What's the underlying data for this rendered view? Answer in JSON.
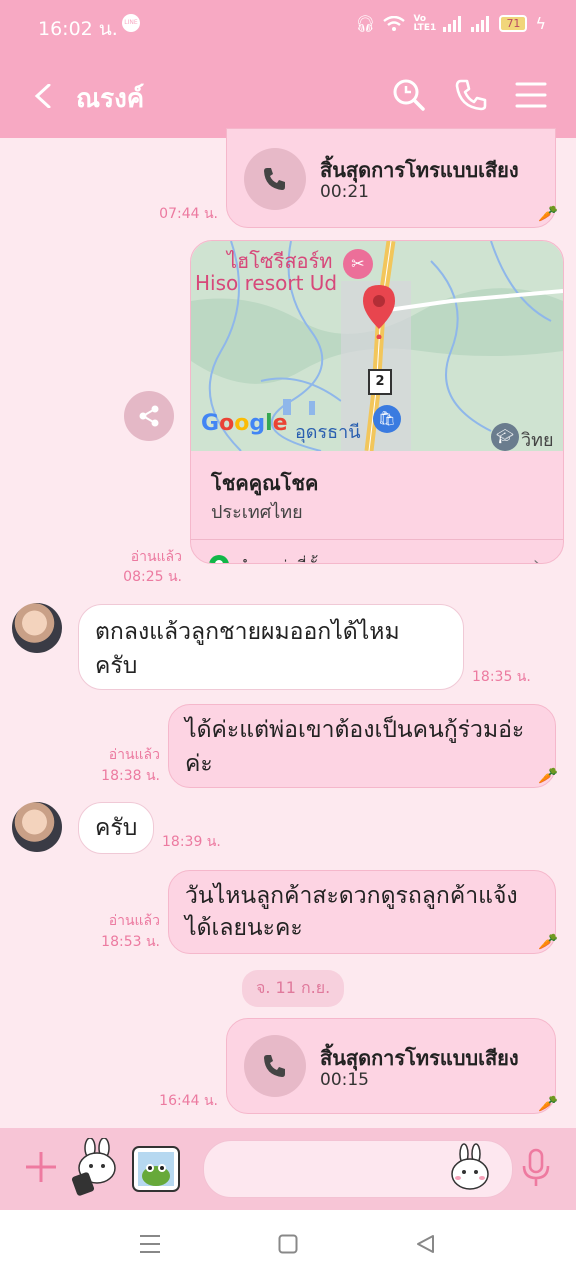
{
  "status": {
    "time": "16:02 น.",
    "network_vo": "Vo LTE1",
    "battery": "71"
  },
  "header": {
    "contact_name": "ณรงค์",
    "colors": {
      "bar": "#f7a9c3",
      "icon": "#ffffff"
    },
    "icons": [
      "chevron-left-icon",
      "search-icon",
      "phone-icon",
      "menu-icon"
    ]
  },
  "messages": {
    "call1": {
      "title": "สิ้นสุดการโทรแบบเสียง",
      "duration": "00:21",
      "time": "07:44 น."
    },
    "location": {
      "map_label_th": "ไฮโซรีสอร์ท",
      "map_label_en": "Hiso resort Ud",
      "map_city": "อุดรธานี",
      "map_city2": "วิทย",
      "map_brand": "Google",
      "route_no": "2",
      "place_title": "โชคคูณโชค",
      "place_subtitle": "ประเทศไทย",
      "link_label": "ตำแหน่งที่ตั้ง",
      "read": "อ่านแล้ว",
      "time": "08:25 น."
    },
    "them1": {
      "text_line1": "ตกลงแล้วลูกชายผมออกได้ไหม",
      "text_line2": "ครับ",
      "time": "18:35 น."
    },
    "me1": {
      "text_line1": "ได้ค่ะแต่พ่อเขาต้องเป็นคนกู้ร่วมอ่ะ",
      "text_line2": "ค่ะ",
      "read": "อ่านแล้ว",
      "time": "18:38 น."
    },
    "them2": {
      "text": "ครับ",
      "time": "18:39 น."
    },
    "me2": {
      "text_line1": "วันไหนลูกค้าสะดวกดูรถลูกค้าแจ้ง",
      "text_line2": "ได้เลยนะคะ",
      "read": "อ่านแล้ว",
      "time": "18:53 น."
    },
    "date_separator": "จ. 11 ก.ย.",
    "call2": {
      "title": "สิ้นสุดการโทรแบบเสียง",
      "duration": "00:15",
      "time": "16:44 น."
    }
  },
  "input": {
    "placeholder": ""
  }
}
